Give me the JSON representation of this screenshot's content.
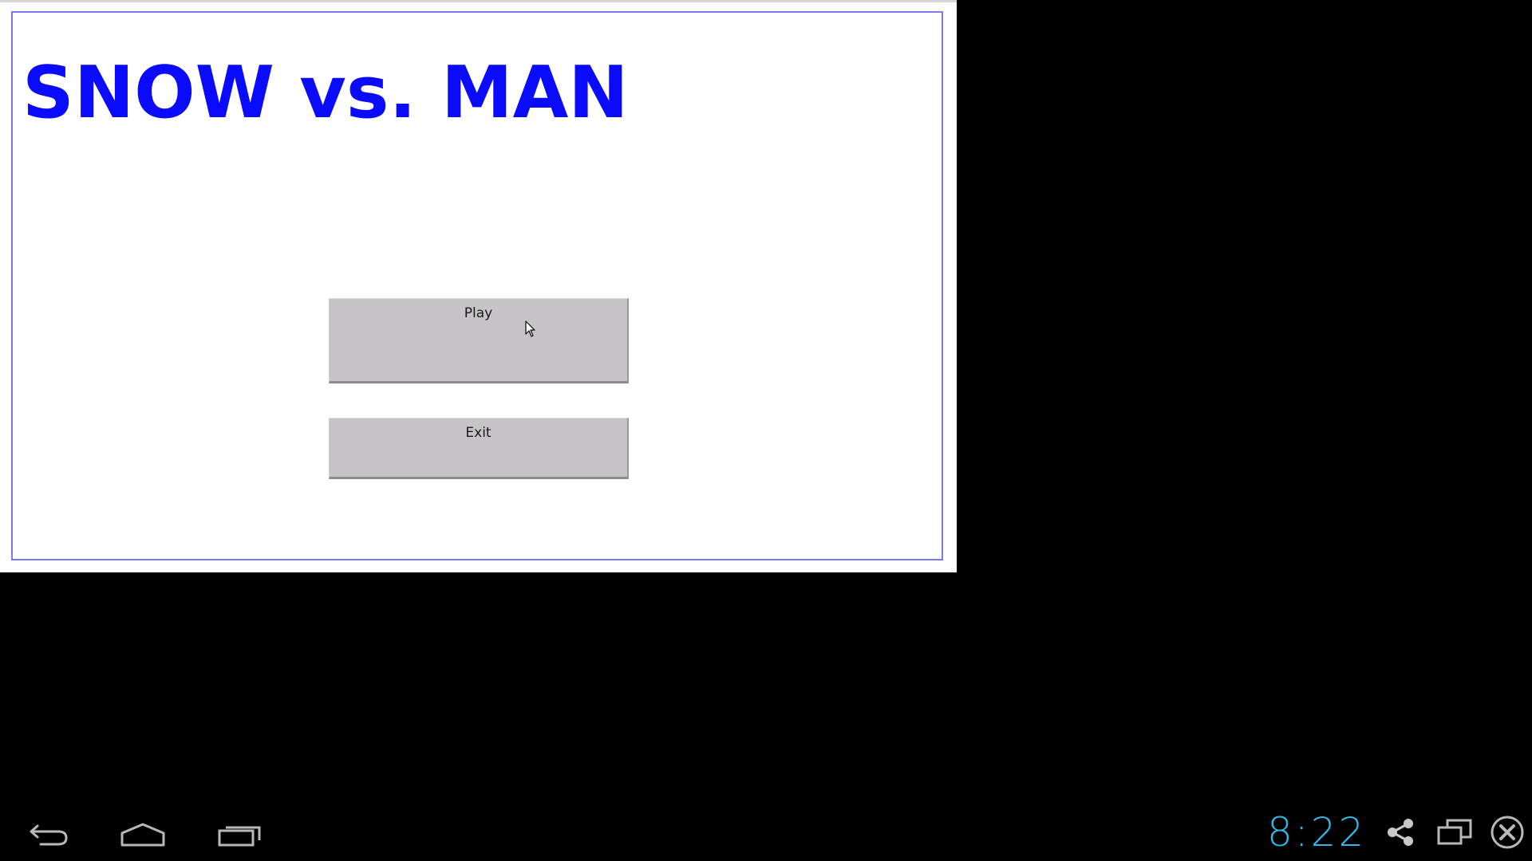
{
  "game": {
    "title": "SNOW vs. MAN",
    "title_color": "#0a0aff",
    "frame_color": "#7a7aee",
    "buttons": {
      "play_label": "Play",
      "exit_label": "Exit"
    }
  },
  "system_bar": {
    "clock": "8:22",
    "clock_color": "#33b5e5",
    "nav_icons": [
      "back-icon",
      "home-icon",
      "recents-icon"
    ],
    "tray_icons": [
      "share-icon",
      "window-icon",
      "close-icon"
    ]
  }
}
